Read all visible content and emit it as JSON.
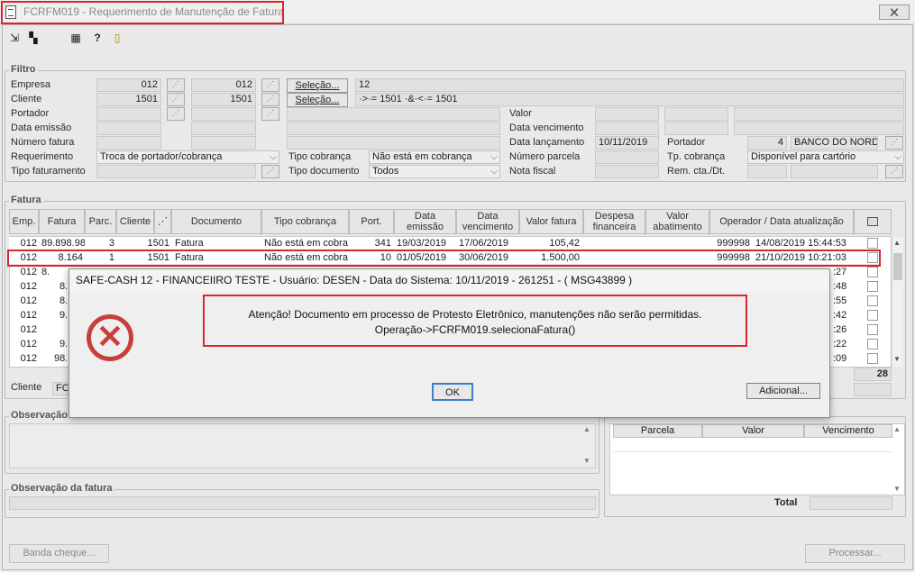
{
  "window": {
    "title": "FCRFM019 - Requerimento de Manutenção de Fatura",
    "close_glyph": "🗙"
  },
  "toolbar": {
    "icons": [
      "export-icon",
      "layers-icon",
      "grid-icon",
      "help-icon",
      "exit-icon"
    ]
  },
  "filtro": {
    "label": "Filtro",
    "empresa": {
      "label": "Empresa",
      "from": "012",
      "to": "012",
      "selecao_label": "Seleção...",
      "selecao_value": "12"
    },
    "cliente": {
      "label": "Cliente",
      "from": "1501",
      "to": "1501",
      "selecao_label": "Seleção...",
      "selecao_value": "·>·= 1501 ·&·<·= 1501"
    },
    "portador_label": "Portador",
    "data_emissao_label": "Data emissão",
    "numero_fatura_label": "Número fatura",
    "requerimento": {
      "label": "Requerimento",
      "value": "Troca de portador/cobrança"
    },
    "tipo_faturamento_label": "Tipo faturamento",
    "tipo_cobranca": {
      "label": "Tipo cobrança",
      "value": "Não está em cobrança"
    },
    "tipo_documento": {
      "label": "Tipo documento",
      "value": "Todos"
    },
    "valor_label": "Valor",
    "data_vencimento_label": "Data vencimento",
    "data_lancamento": {
      "label": "Data lançamento",
      "value": "10/11/2019"
    },
    "numero_parcela_label": "Número parcela",
    "nota_fiscal_label": "Nota fiscal",
    "portador_right": {
      "label": "Portador",
      "code": "4",
      "name": "BANCO DO NORDE"
    },
    "tp_cobranca": {
      "label": "Tp. cobrança",
      "value": "Disponível para cartório"
    },
    "rem_cta_label": "Rem. cta./Dt."
  },
  "fatura": {
    "label": "Fatura",
    "columns": [
      "Emp.",
      "Fatura",
      "Parc.",
      "Cliente",
      "",
      "Documento",
      "Tipo cobrança",
      "Port.",
      "Data emissão",
      "Data vencimento",
      "Valor fatura",
      "Despesa financeira",
      "Valor abatimento",
      "Operador / Data atualização"
    ],
    "rows": [
      {
        "emp": "012",
        "fatura": "89.898.98",
        "parc": "3",
        "cliente": "1501",
        "doc": "Fatura",
        "tipo": "Não está em cobra",
        "port": "341",
        "emissao": "19/03/2019",
        "venc": "17/06/2019",
        "valor": "105,42",
        "operador": "999998",
        "atual": "14/08/2019 15:44:53"
      },
      {
        "emp": "012",
        "fatura": "8.164",
        "parc": "1",
        "cliente": "1501",
        "doc": "Fatura",
        "tipo": "Não está em cobra",
        "port": "10",
        "emissao": "01/05/2019",
        "venc": "30/06/2019",
        "valor": "1.500,00",
        "operador": "999998",
        "atual": "21/10/2019 10:21:03"
      },
      {
        "emp": "012",
        "fatura": "8.",
        "tail": ":27"
      },
      {
        "emp": "012",
        "fatura": "8.",
        "tail": ":48"
      },
      {
        "emp": "012",
        "fatura": "8.",
        "tail": ":55"
      },
      {
        "emp": "012",
        "fatura": "9.",
        "tail": ":42"
      },
      {
        "emp": "012",
        "fatura": "",
        "tail": ":26"
      },
      {
        "emp": "012",
        "fatura": "9.",
        "tail": ":22"
      },
      {
        "emp": "012",
        "fatura": "98.",
        "tail": ":09"
      }
    ],
    "count": "28",
    "cliente_label": "Cliente",
    "cliente_value": "FO"
  },
  "observacao_label": "Observação",
  "nota_fiscal": {
    "columns": [
      "Parcela",
      "Valor",
      "Vencimento"
    ],
    "total_label": "Total"
  },
  "observacao_fatura_label": "Observação da fatura",
  "footer": {
    "banda_cheque": "Banda cheque...",
    "processar": "Processar..."
  },
  "dialog": {
    "title": "SAFE-CASH 12 - FINANCEIIRO TESTE - Usuário: DESEN - Data do Sistema: 10/11/2019 - 261251 - ( MSG43899 )",
    "icon": "error-icon",
    "line1": "Atenção! Documento em processo de Protesto Eletrônico, manutenções não serão permitidas.",
    "line2": "Operação->FCRFM019.selecionaFatura()",
    "ok": "OK",
    "adicional": "Adicional..."
  },
  "colors": {
    "highlight": "#d9262e",
    "error": "#c8403a"
  }
}
